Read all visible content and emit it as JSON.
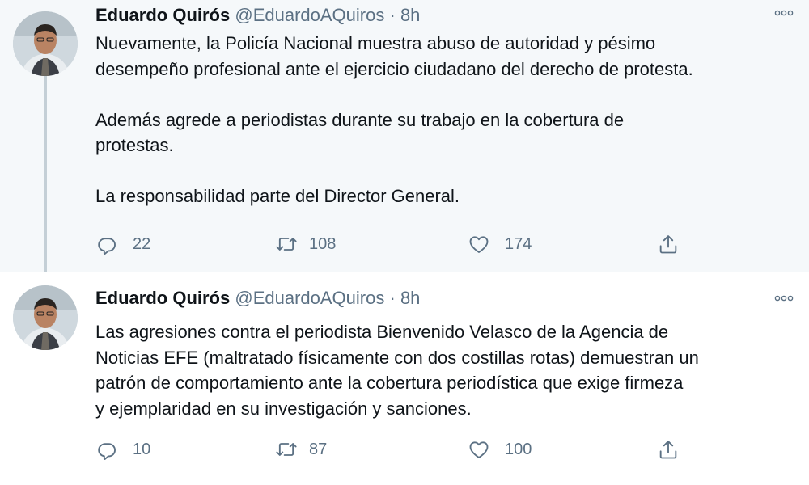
{
  "colors": {
    "secondary_text": "#5b7083",
    "thread_line": "#c4cfd6",
    "highlight_bg": "#f5f8fa"
  },
  "tweets": [
    {
      "author": {
        "name": "Eduardo Quirós",
        "handle": "@EduardoAQuiros"
      },
      "separator": "·",
      "time": "8h",
      "text": "Nuevamente, la Policía Nacional muestra abuso de autoridad y pésimo\ndesempeño profesional ante el ejercicio ciudadano del derecho de protesta.\n\nAdemás agrede a periodistas durante su trabajo en la cobertura de\nprotestas.\n\nLa responsabilidad parte del Director General.",
      "counts": {
        "replies": "22",
        "retweets": "108",
        "likes": "174"
      }
    },
    {
      "author": {
        "name": "Eduardo Quirós",
        "handle": "@EduardoAQuiros"
      },
      "separator": "·",
      "time": "8h",
      "text": "Las agresiones contra el periodista Bienvenido Velasco de la Agencia de\nNoticias EFE (maltratado físicamente con dos costillas rotas) demuestran un\npatrón de comportamiento ante la cobertura periodística que exige firmeza\ny ejemplaridad en su investigación y sanciones.",
      "counts": {
        "replies": "10",
        "retweets": "87",
        "likes": "100"
      }
    }
  ],
  "icons": {
    "more": "more-icon",
    "reply": "reply-icon",
    "retweet": "retweet-icon",
    "like": "heart-icon",
    "share": "share-icon"
  }
}
